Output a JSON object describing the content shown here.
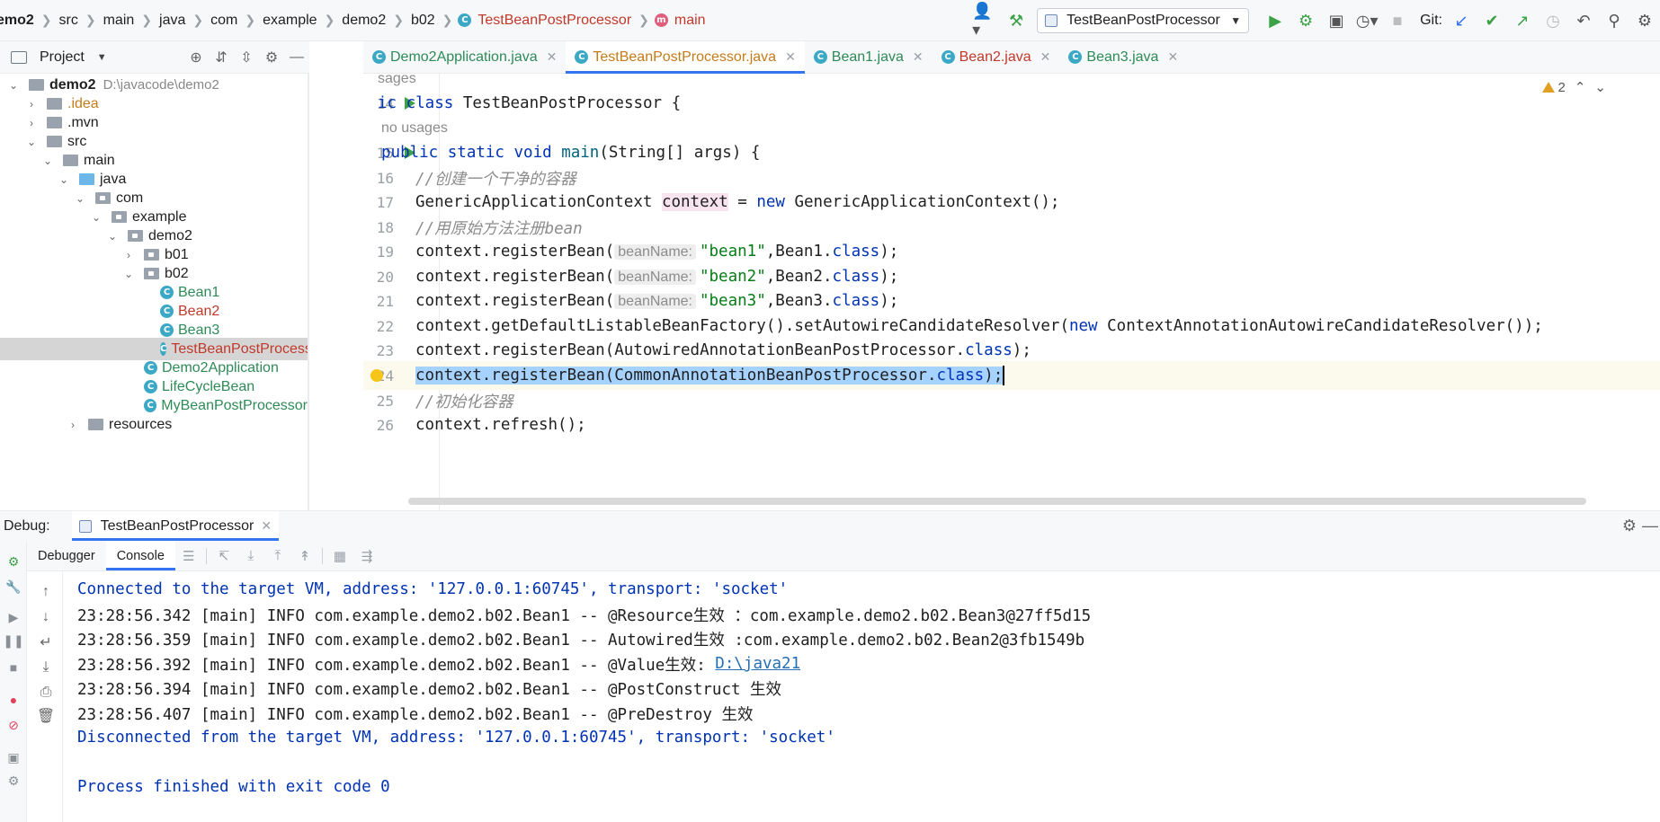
{
  "breadcrumb": {
    "items": [
      {
        "label": "emo2"
      },
      {
        "label": "src"
      },
      {
        "label": "main"
      },
      {
        "label": "java"
      },
      {
        "label": "com"
      },
      {
        "label": "example"
      },
      {
        "label": "demo2"
      },
      {
        "label": "b02"
      },
      {
        "label": "TestBeanPostProcessor",
        "icon": "class-icon"
      },
      {
        "label": "main",
        "icon": "method-icon"
      }
    ]
  },
  "toolbar": {
    "run_config": "TestBeanPostProcessor",
    "git_label": "Git:"
  },
  "project": {
    "title": "Project",
    "tree": [
      {
        "label": "demo2",
        "path": "D:\\javacode\\demo2"
      },
      {
        "label": ".idea"
      },
      {
        "label": ".mvn"
      },
      {
        "label": "src"
      },
      {
        "label": "main"
      },
      {
        "label": "java"
      },
      {
        "label": "com"
      },
      {
        "label": "example"
      },
      {
        "label": "demo2"
      },
      {
        "label": "b01"
      },
      {
        "label": "b02"
      },
      {
        "label": "Bean1"
      },
      {
        "label": "Bean2"
      },
      {
        "label": "Bean3"
      },
      {
        "label": "TestBeanPostProcessor"
      },
      {
        "label": "Demo2Application"
      },
      {
        "label": "LifeCycleBean"
      },
      {
        "label": "MyBeanPostProcessor"
      },
      {
        "label": "resources"
      }
    ]
  },
  "tabs": [
    {
      "label": "Demo2Application.java"
    },
    {
      "label": "TestBeanPostProcessor.java"
    },
    {
      "label": "Bean1.java"
    },
    {
      "label": "Bean2.java"
    },
    {
      "label": "Bean3.java"
    }
  ],
  "editor": {
    "warning_count": "2",
    "usages_hint_top": "sages",
    "usages_hint": "no usages",
    "lines": [
      {
        "num": "14",
        "class_kw": "ic class",
        "class_name": " TestBeanPostProcessor {"
      },
      {
        "num": "15",
        "kw1": "public static void",
        "method": " main",
        "rest": "(String[] args) {"
      },
      {
        "num": "16",
        "comment": "//创建一个干净的容器"
      },
      {
        "num": "17",
        "type": "GenericApplicationContext ",
        "var": "context",
        "eq": " = ",
        "new_kw": "new",
        "ctor": " GenericApplicationContext();"
      },
      {
        "num": "18",
        "comment": "//用原始方法注册bean"
      },
      {
        "num": "19",
        "call": "context.registerBean(",
        "param": "beanName:",
        "str": "\"bean1\"",
        "cls": ",Bean1.",
        "class_kw": "class",
        "end": ");"
      },
      {
        "num": "20",
        "call": "context.registerBean(",
        "param": "beanName:",
        "str": "\"bean2\"",
        "cls": ",Bean2.",
        "class_kw": "class",
        "end": ");"
      },
      {
        "num": "21",
        "call": "context.registerBean(",
        "param": "beanName:",
        "str": "\"bean3\"",
        "cls": ",Bean3.",
        "class_kw": "class",
        "end": ");"
      },
      {
        "num": "22",
        "call": "context.getDefaultListableBeanFactory().setAutowireCandidateResolver(",
        "new_kw": "new",
        "rest": " ContextAnnotationAutowireCandidateResolver());"
      },
      {
        "num": "23",
        "call": "context.registerBean(AutowiredAnnotationBeanPostProcessor.",
        "class_kw": "class",
        "end": ");"
      },
      {
        "num": "24",
        "call": "context.registerBean(CommonAnnotationBeanPostProcessor.",
        "class_kw": "class",
        "end": ");"
      },
      {
        "num": "25",
        "comment": "//初始化容器"
      },
      {
        "num": "26",
        "call": "context.refresh();"
      }
    ]
  },
  "debug": {
    "title": "Debug:",
    "session_tab": "TestBeanPostProcessor",
    "tabs": [
      {
        "label": "Debugger"
      },
      {
        "label": "Console"
      }
    ],
    "console": [
      {
        "text": "Connected to the target VM, address: '127.0.0.1:60745', transport: 'socket'"
      },
      {
        "text": "23:28:56.342 [main] INFO com.example.demo2.b02.Bean1 -- @Resource生效 ：com.example.demo2.b02.Bean3@27ff5d15"
      },
      {
        "text": "23:28:56.359 [main] INFO com.example.demo2.b02.Bean1 -- Autowired生效 :com.example.demo2.b02.Bean2@3fb1549b"
      },
      {
        "text": "23:28:56.392 [main] INFO com.example.demo2.b02.Bean1 -- @Value生效: ",
        "link": "D:\\java21"
      },
      {
        "text": "23:28:56.394 [main] INFO com.example.demo2.b02.Bean1 -- @PostConstruct 生效"
      },
      {
        "text": "23:28:56.407 [main] INFO com.example.demo2.b02.Bean1 -- @PreDestroy 生效"
      },
      {
        "text": "Disconnected from the target VM, address: '127.0.0.1:60745', transport: 'socket'"
      },
      {
        "text": "Process finished with exit code 0"
      }
    ]
  },
  "colors": {
    "accent": "#3574f0",
    "keyword": "#0033b3",
    "string": "#067d17",
    "comment": "#8c8c8c",
    "selection": "#a6d2ff",
    "run_green": "#3ca147"
  }
}
